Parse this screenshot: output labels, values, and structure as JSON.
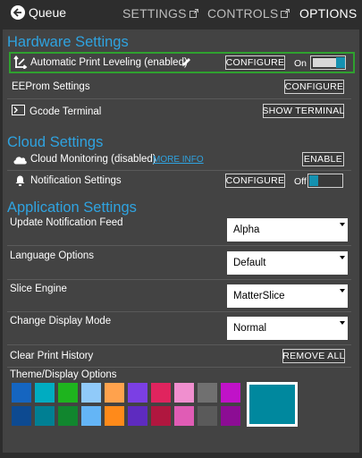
{
  "nav": {
    "back_label": "Queue",
    "tabs": [
      {
        "label": "SETTINGS",
        "active": false
      },
      {
        "label": "CONTROLS",
        "active": false
      },
      {
        "label": "OPTIONS",
        "active": true
      }
    ]
  },
  "hardware": {
    "title": "Hardware Settings",
    "auto_leveling": {
      "label": "Automatic Print Leveling (enabled)",
      "button": "CONFIGURE",
      "toggle_label": "On",
      "toggle_on": true
    },
    "eeprom": {
      "label": "EEProm Settings",
      "button": "CONFIGURE"
    },
    "gcode": {
      "label": "Gcode Terminal",
      "button": "SHOW TERMINAL"
    }
  },
  "cloud": {
    "title": "Cloud Settings",
    "monitoring": {
      "label": "Cloud Monitoring (disabled)",
      "link": "MORE INFO",
      "button": "ENABLE"
    },
    "notifications": {
      "label": "Notification Settings",
      "button": "CONFIGURE",
      "toggle_label": "Off",
      "toggle_on": false
    }
  },
  "application": {
    "title": "Application Settings",
    "update_feed": {
      "label": "Update Notification Feed",
      "value": "Alpha"
    },
    "language": {
      "label": "Language Options",
      "value": "Default"
    },
    "slice_engine": {
      "label": "Slice Engine",
      "value": "MatterSlice"
    },
    "display_mode": {
      "label": "Change Display Mode",
      "value": "Normal"
    },
    "clear_history": {
      "label": "Clear Print History",
      "button": "REMOVE ALL"
    },
    "theme": {
      "label": "Theme/Display Options",
      "swatches_top": [
        "#1565c0",
        "#00acc1",
        "#1eb41e",
        "#90caf9",
        "#ffa24d",
        "#7b3fe4",
        "#e0245e",
        "#f08fcf",
        "#707070",
        "#c012c8"
      ],
      "swatches_bottom": [
        "#0d4a91",
        "#007f93",
        "#11862e",
        "#64b5f6",
        "#ff8a1a",
        "#5e2bbf",
        "#b0173f",
        "#e05cb5",
        "#5a5a5a",
        "#8c0d94"
      ],
      "selected_color": "#00889e"
    }
  },
  "colors": {
    "accent": "#2fa3e0",
    "highlight_border": "#2fa12f",
    "panel": "#434343",
    "background": "#2d2d2d"
  }
}
